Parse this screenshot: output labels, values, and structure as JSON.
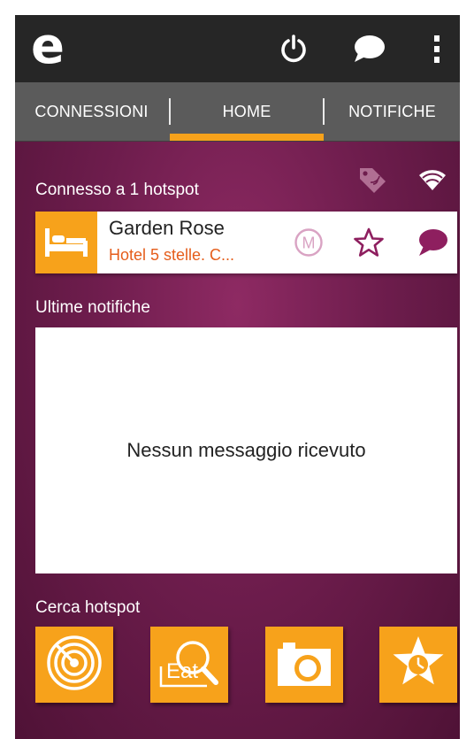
{
  "app": {
    "logo_letter": "e",
    "accent_color": "#f7a21b",
    "background_color": "#6e1d4d"
  },
  "action_bar": {
    "icons": [
      "power-icon",
      "chat-icon",
      "overflow-menu-icon"
    ]
  },
  "tabs": [
    {
      "label": "CONNESSIONI",
      "selected": false
    },
    {
      "label": "HOME",
      "selected": true
    },
    {
      "label": "NOTIFICHE",
      "selected": false
    }
  ],
  "connection": {
    "header": "Connesso a 1 hotspot",
    "status_icons": [
      "tag-icon",
      "wifi-icon"
    ]
  },
  "hotspot": {
    "name": "Garden Rose",
    "subtitle": "Hotel 5 stelle. C...",
    "category_icon": "bed-icon",
    "subtitle_color": "#e55d1b",
    "actions": [
      {
        "icon": "m-badge-icon"
      },
      {
        "icon": "star-outline-icon"
      },
      {
        "icon": "speech-bubble-icon"
      }
    ]
  },
  "notifications": {
    "header": "Ultime notifiche",
    "empty_message": "Nessun messaggio ricevuto"
  },
  "search": {
    "header": "Cerca hotspot",
    "tiles": [
      {
        "icon": "radar-icon"
      },
      {
        "icon": "eat-search-icon",
        "label": "Eat"
      },
      {
        "icon": "camera-icon"
      },
      {
        "icon": "star-clock-icon"
      }
    ]
  }
}
